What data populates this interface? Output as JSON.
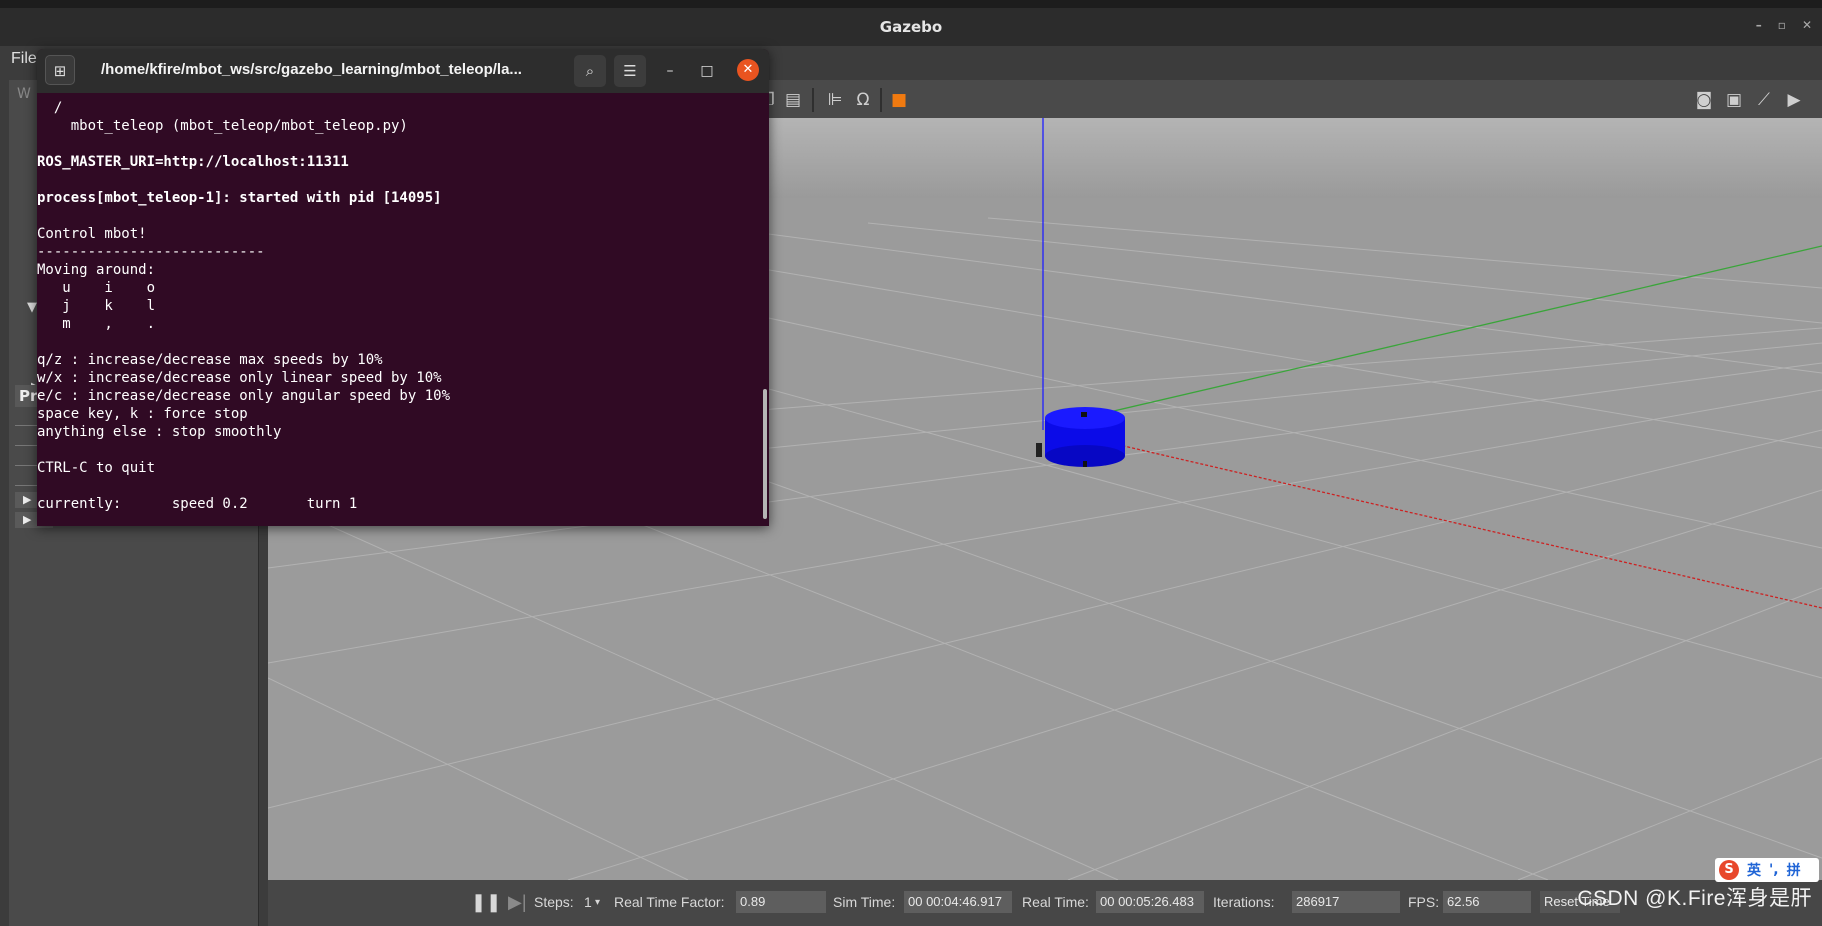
{
  "window": {
    "title": "Gazebo",
    "menu_file": "File"
  },
  "left_panel": {
    "tab_label": "W",
    "props_label": "Pro"
  },
  "toolbar": {
    "icons": [
      "copy-icon",
      "paste-icon",
      "align-icon",
      "snap-icon",
      "view-angle-icon",
      "screenshot-icon",
      "log-icon",
      "plot-icon",
      "video-record-icon"
    ]
  },
  "terminal": {
    "title": "/home/kfire/mbot_ws/src/gazebo_learning/mbot_teleop/la...",
    "lines": [
      {
        "text": "  /",
        "bold": false
      },
      {
        "text": "    mbot_teleop (mbot_teleop/mbot_teleop.py)",
        "bold": false
      },
      {
        "text": "",
        "bold": false
      },
      {
        "text": "ROS_MASTER_URI=http://localhost:11311",
        "bold": true
      },
      {
        "text": "",
        "bold": false
      },
      {
        "text": "process[mbot_teleop-1]: started with pid [14095]",
        "bold": true
      },
      {
        "text": "",
        "bold": false
      },
      {
        "text": "Control mbot!",
        "bold": false
      },
      {
        "text": "---------------------------",
        "bold": false
      },
      {
        "text": "Moving around:",
        "bold": false
      },
      {
        "text": "   u    i    o",
        "bold": false
      },
      {
        "text": "   j    k    l",
        "bold": false
      },
      {
        "text": "   m    ,    .",
        "bold": false
      },
      {
        "text": "",
        "bold": false
      },
      {
        "text": "q/z : increase/decrease max speeds by 10%",
        "bold": false
      },
      {
        "text": "w/x : increase/decrease only linear speed by 10%",
        "bold": false
      },
      {
        "text": "e/c : increase/decrease only angular speed by 10%",
        "bold": false
      },
      {
        "text": "space key, k : force stop",
        "bold": false
      },
      {
        "text": "anything else : stop smoothly",
        "bold": false
      },
      {
        "text": "",
        "bold": false
      },
      {
        "text": "CTRL-C to quit",
        "bold": false
      },
      {
        "text": "",
        "bold": false
      },
      {
        "text": "currently:      speed 0.2       turn 1",
        "bold": false
      }
    ]
  },
  "bottombar": {
    "steps_label": "Steps:",
    "steps_value": "1",
    "rtf_label": "Real Time Factor:",
    "rtf_value": "0.89",
    "sim_time_label": "Sim Time:",
    "sim_time_value": "00 00:04:46.917",
    "real_time_label": "Real Time:",
    "real_time_value": "00 00:05:26.483",
    "iterations_label": "Iterations:",
    "iterations_value": "286917",
    "fps_label": "FPS:",
    "fps_value": "62.56",
    "reset_label": "Reset Time"
  },
  "overlay": {
    "watermark": "CSDN @K.Fire浑身是肝",
    "ime_lang": "英",
    "ime_punct": "',",
    "ime_mode": "拼",
    "ime_logo": "S"
  },
  "colors": {
    "terminal_bg": "#300a24",
    "robot": "#0b0be8",
    "z_axis": "#2222ff",
    "y_axis": "#3aa53a",
    "x_axis": "#cc2222",
    "close_button": "#e95420"
  }
}
